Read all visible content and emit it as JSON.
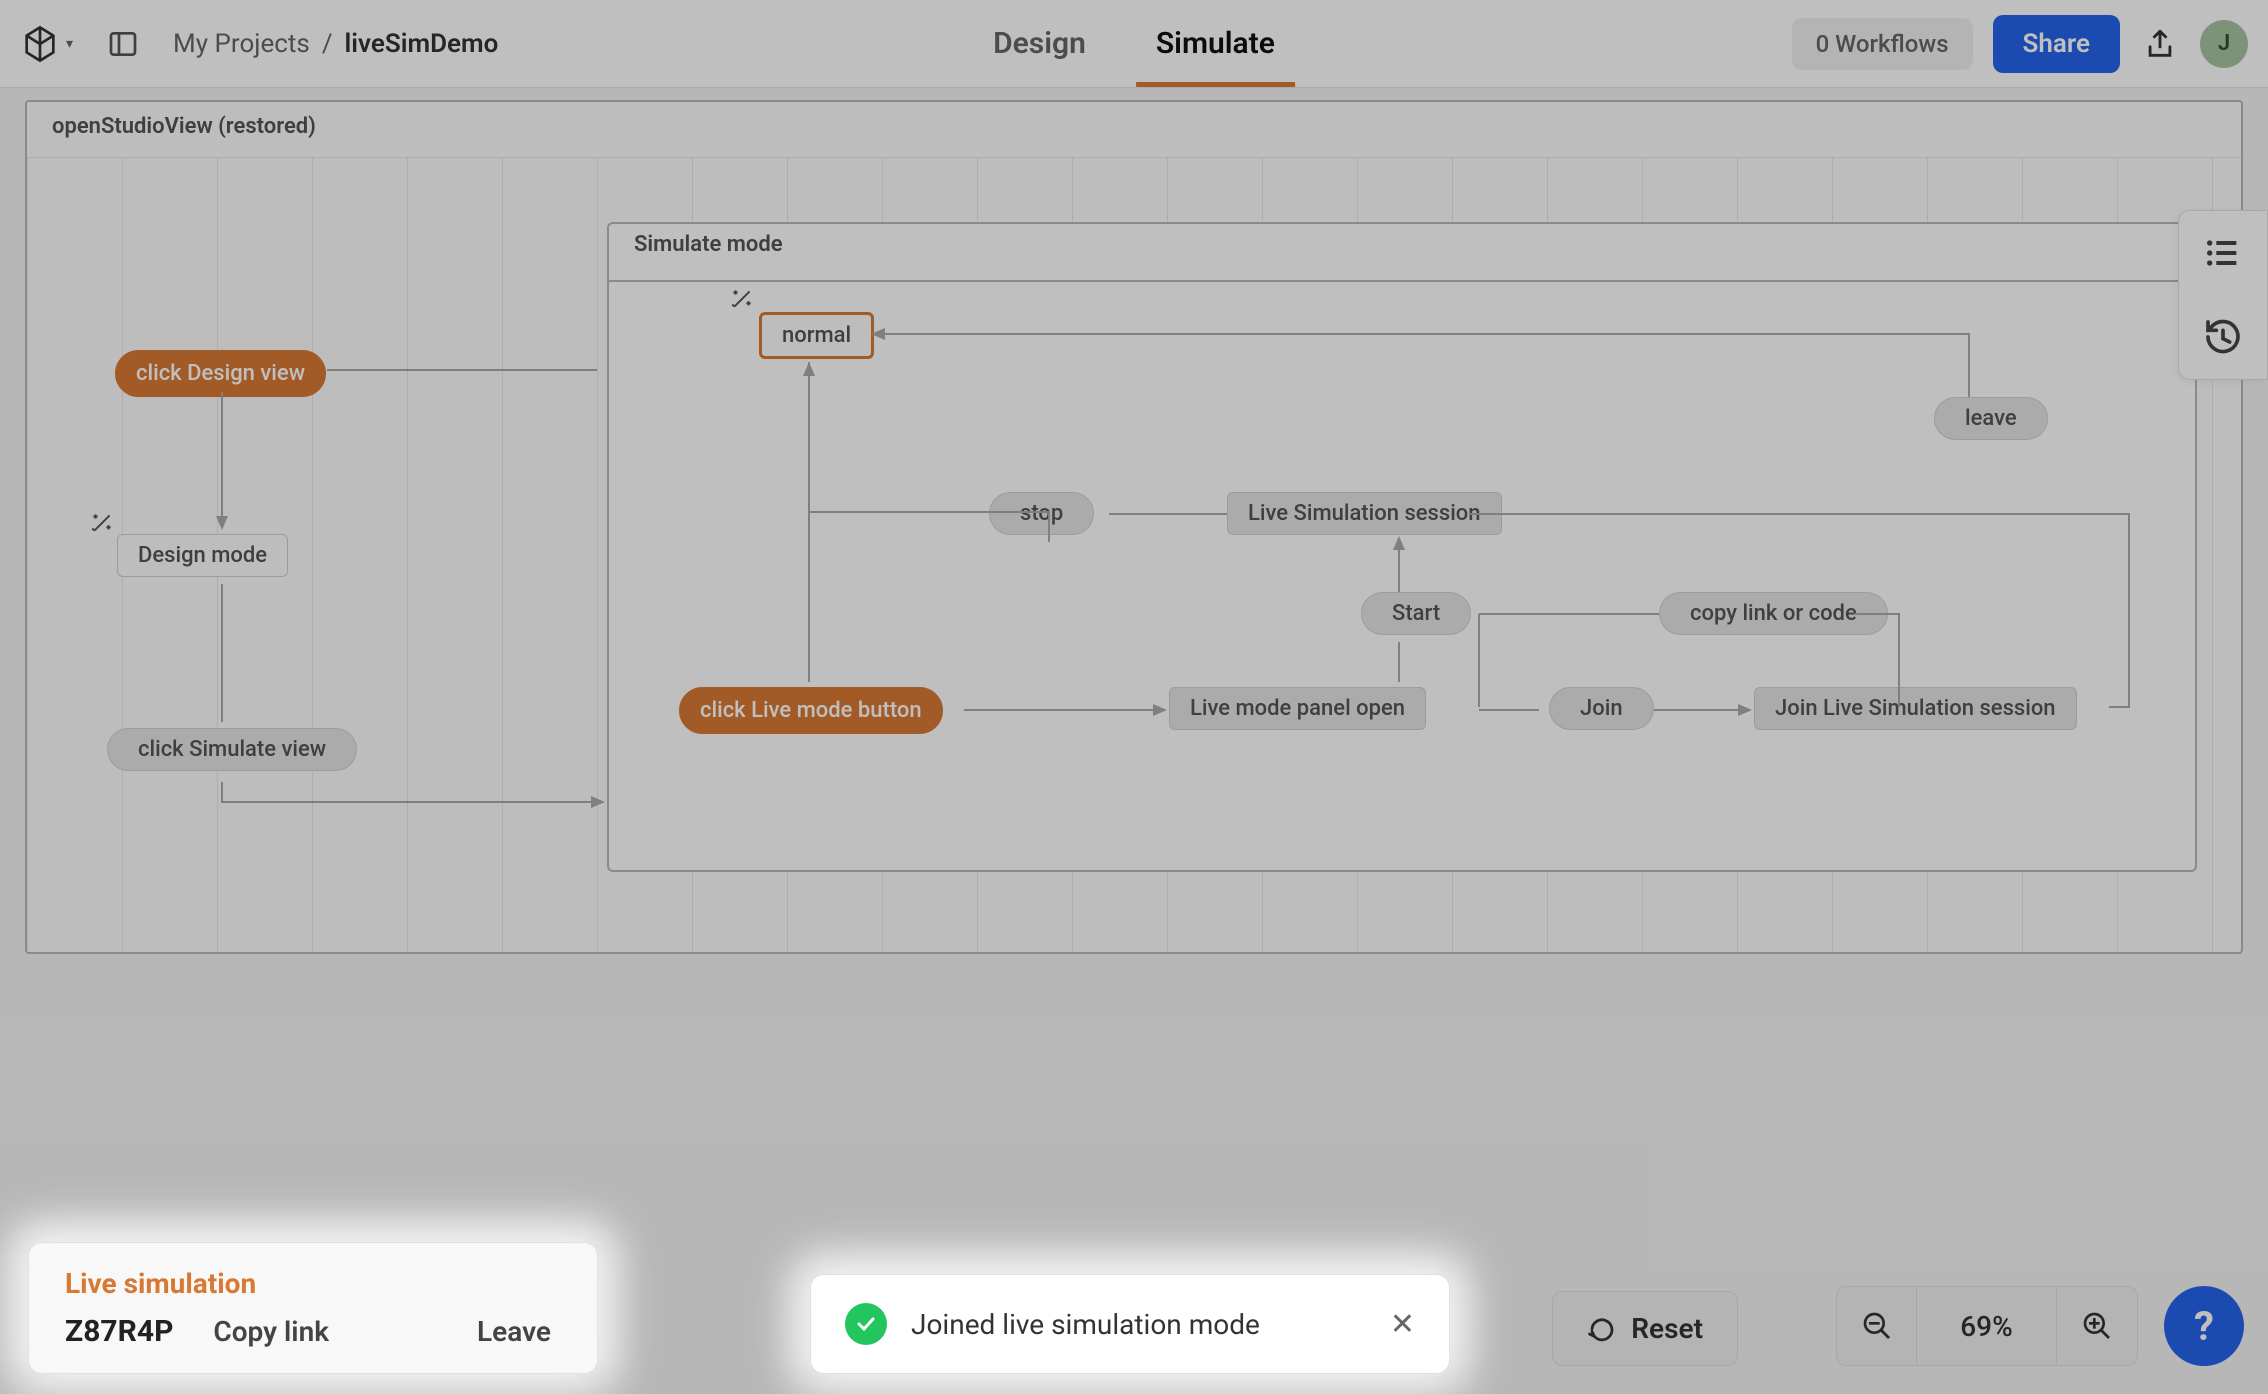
{
  "header": {
    "breadcrumb_root": "My Projects",
    "breadcrumb_sep": "/",
    "project_name": "liveSimDemo",
    "tabs": {
      "design": "Design",
      "simulate": "Simulate"
    },
    "workflows": "0 Workflows",
    "share": "Share",
    "avatar_initial": "J"
  },
  "canvas": {
    "outer_title": "openStudioView (restored)",
    "sim_box_title": "Simulate mode",
    "nodes": {
      "click_design": "click Design view",
      "design_mode": "Design mode",
      "click_simulate": "click Simulate view",
      "click_live_mode": "click Live mode button",
      "normal": "normal",
      "stop": "stop",
      "live_session": "Live Simulation session",
      "start": "Start",
      "copy_link": "copy link or code",
      "live_panel_open": "Live mode panel open",
      "join": "Join",
      "join_live": "Join Live Simulation session",
      "leave": "leave"
    }
  },
  "live_panel": {
    "title": "Live simulation",
    "code": "Z87R4P",
    "copy_link": "Copy link",
    "leave": "Leave"
  },
  "toast": {
    "message": "Joined live simulation mode"
  },
  "controls": {
    "reset": "Reset",
    "zoom": "69%"
  }
}
